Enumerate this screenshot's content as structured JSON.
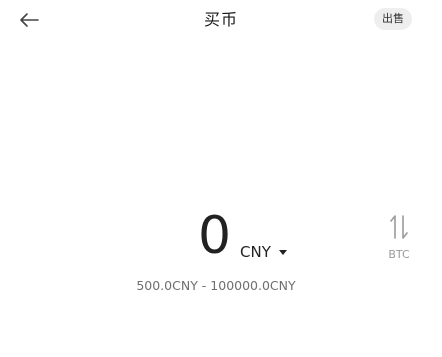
{
  "header": {
    "title": "买币",
    "sell_label": "出售"
  },
  "amount": {
    "value": "0",
    "currency": "CNY"
  },
  "switch": {
    "label": "BTC"
  },
  "range": {
    "text": "500.0CNY - 100000.0CNY"
  },
  "icons": {
    "back": "arrow-left-icon",
    "swap": "swap-vertical-icon",
    "caret": "caret-down-icon"
  },
  "colors": {
    "text": "#222222",
    "muted": "#9a9a9a",
    "pill_bg": "#eeeeee"
  }
}
